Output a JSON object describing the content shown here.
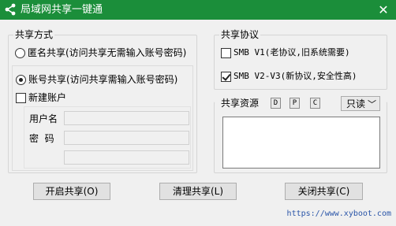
{
  "window": {
    "title": "局域网共享一键通",
    "close_glyph": "✕"
  },
  "share_mode": {
    "title": "共享方式",
    "anonymous_label": "匿名共享(访问共享无需输入账号密码)",
    "account_label": "账号共享(访问共享需输入账号密码)",
    "new_account_label": "新建账户",
    "username_label": "用户名",
    "password_label": "密  码"
  },
  "protocol": {
    "title": "共享协议",
    "smb1_label": "SMB V1(老协议,旧系统需要)",
    "smb23_label": "SMB V2-V3(新协议,安全性高)"
  },
  "resources": {
    "title": "共享资源",
    "drives": [
      "D",
      "P",
      "C"
    ],
    "permission": "只读"
  },
  "buttons": {
    "start": "开启共享(O)",
    "clean": "清理共享(L)",
    "stop": "关闭共享(C)"
  },
  "footer": {
    "url": "https://www.xyboot.com"
  },
  "state": {
    "anonymous_selected": false,
    "account_selected": true,
    "new_account_checked": false,
    "smb1_checked": false,
    "smb23_checked": true
  },
  "colors": {
    "titlebar": "#1b8e3a",
    "url": "#2a55a8"
  }
}
